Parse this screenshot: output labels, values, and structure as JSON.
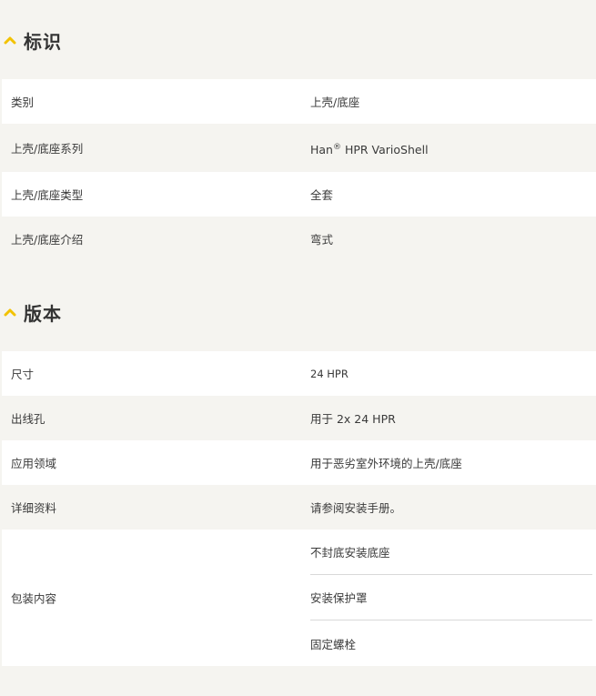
{
  "colors": {
    "accent": "#f2c200",
    "page_bg": "#f5f4f0",
    "row_alt": "#ffffff"
  },
  "sections": [
    {
      "title": "标识",
      "icon": "chevron-up-icon",
      "rows": [
        {
          "label": "类别",
          "value": "上壳/底座"
        },
        {
          "label": "上壳/底座系列",
          "value_prefix": "Han",
          "value_sup": "®",
          "value_suffix": " HPR VarioShell"
        },
        {
          "label": "上壳/底座类型",
          "value": "全套"
        },
        {
          "label": "上壳/底座介绍",
          "value": "弯式"
        }
      ]
    },
    {
      "title": "版本",
      "icon": "chevron-up-icon",
      "rows": [
        {
          "label": "尺寸",
          "value": "24 HPR"
        },
        {
          "label": "出线孔",
          "value": "用于 2x 24 HPR"
        },
        {
          "label": "应用领域",
          "value": "用于恶劣室外环境的上壳/底座"
        },
        {
          "label": "详细资料",
          "value": "请参阅安装手册。"
        },
        {
          "label": "包装内容",
          "values": [
            "不封底安装底座",
            "安装保护罩",
            "固定螺栓"
          ]
        }
      ]
    }
  ]
}
